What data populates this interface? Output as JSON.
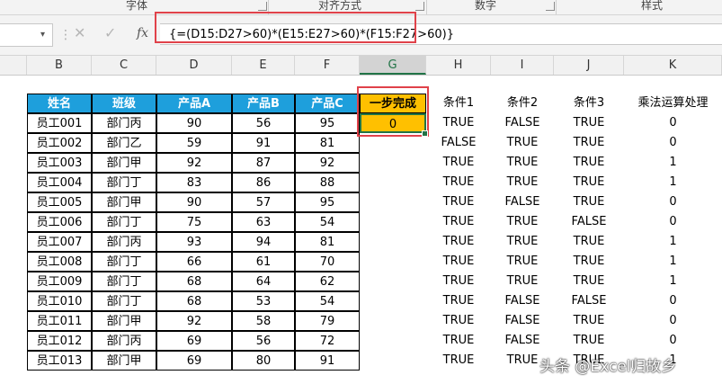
{
  "ribbon": {
    "groups": [
      "字体",
      "对齐方式",
      "数字",
      "样式"
    ]
  },
  "formula_bar": {
    "cancel_glyph": "✕",
    "enter_glyph": "✓",
    "fx_label": "fx",
    "formula": "{=(D15:D27>60)*(E15:E27>60)*(F15:F27>60)}"
  },
  "columns": [
    "B",
    "C",
    "D",
    "E",
    "F",
    "G",
    "H",
    "I",
    "J",
    "K"
  ],
  "selected_column": "G",
  "headers": {
    "name": "姓名",
    "class": "班级",
    "a": "产品A",
    "b": "产品B",
    "c": "产品C",
    "one_step": "一步完成",
    "cond1": "条件1",
    "cond2": "条件2",
    "cond3": "条件3",
    "mult": "乘法运算处理"
  },
  "result_value": "0",
  "rows": [
    [
      "员工001",
      "部门丙",
      "90",
      "56",
      "95",
      "TRUE",
      "FALSE",
      "TRUE",
      "0"
    ],
    [
      "员工002",
      "部门乙",
      "59",
      "91",
      "81",
      "FALSE",
      "TRUE",
      "TRUE",
      "0"
    ],
    [
      "员工003",
      "部门甲",
      "92",
      "87",
      "92",
      "TRUE",
      "TRUE",
      "TRUE",
      "1"
    ],
    [
      "员工004",
      "部门丁",
      "83",
      "86",
      "88",
      "TRUE",
      "TRUE",
      "TRUE",
      "1"
    ],
    [
      "员工005",
      "部门甲",
      "90",
      "57",
      "95",
      "TRUE",
      "FALSE",
      "TRUE",
      "0"
    ],
    [
      "员工006",
      "部门丁",
      "75",
      "63",
      "54",
      "TRUE",
      "TRUE",
      "FALSE",
      "0"
    ],
    [
      "员工007",
      "部门丙",
      "93",
      "94",
      "81",
      "TRUE",
      "TRUE",
      "TRUE",
      "1"
    ],
    [
      "员工008",
      "部门丁",
      "66",
      "61",
      "70",
      "TRUE",
      "TRUE",
      "TRUE",
      "1"
    ],
    [
      "员工009",
      "部门丁",
      "68",
      "64",
      "62",
      "TRUE",
      "TRUE",
      "TRUE",
      "1"
    ],
    [
      "员工010",
      "部门丁",
      "68",
      "53",
      "54",
      "TRUE",
      "FALSE",
      "FALSE",
      "0"
    ],
    [
      "员工011",
      "部门甲",
      "92",
      "58",
      "79",
      "TRUE",
      "FALSE",
      "TRUE",
      "0"
    ],
    [
      "员工012",
      "部门丙",
      "69",
      "56",
      "72",
      "TRUE",
      "FALSE",
      "TRUE",
      "0"
    ],
    [
      "员工013",
      "部门甲",
      "69",
      "80",
      "91",
      "TRUE",
      "TRUE",
      "TRUE",
      "1"
    ]
  ],
  "watermark": "头条 @Excel归故乡"
}
